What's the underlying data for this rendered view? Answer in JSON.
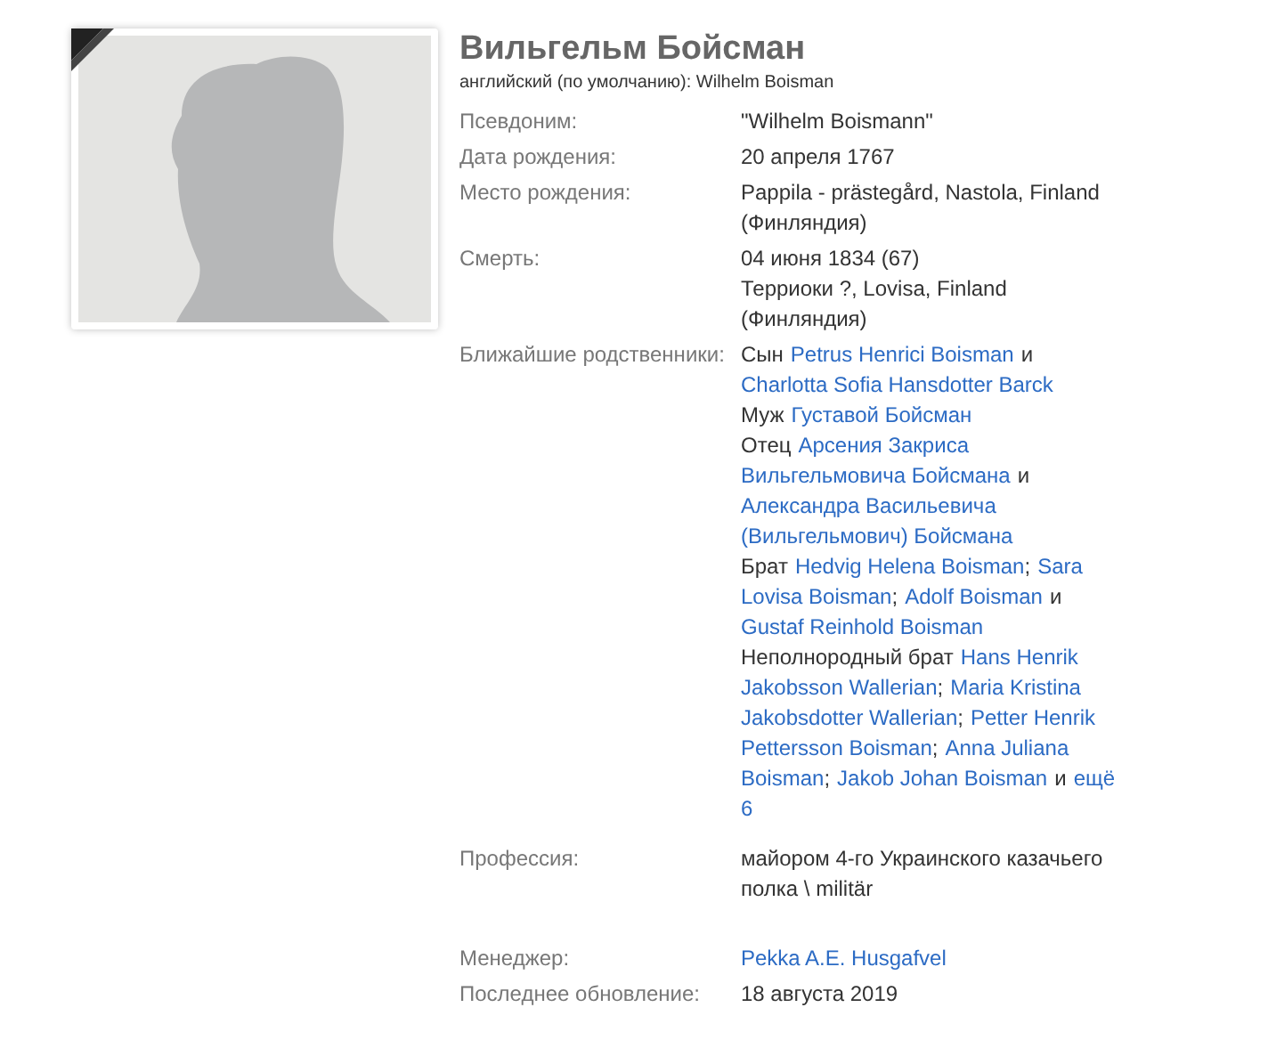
{
  "profile": {
    "name": "Вильгельм Бойсман",
    "alt_name": "английский (по умолчанию): Wilhelm Boisman",
    "deceased": true
  },
  "facts": [
    {
      "label": "Псевдоним:",
      "lines": [
        "\"Wilhelm Boismann\""
      ]
    },
    {
      "label": "Дата рождения:",
      "lines": [
        "20 апреля 1767"
      ]
    },
    {
      "label": "Место рождения:",
      "lines": [
        "Pappila - prästegård, Nastola, Finland",
        "(Финляндия)"
      ]
    },
    {
      "label": "Смерть:",
      "lines": [
        "04 июня 1834 (67)",
        "Терриоки ?, Lovisa, Finland",
        "(Финляндия)"
      ]
    }
  ],
  "relatives": {
    "label": "Ближайшие родственники:",
    "lines": [
      [
        {
          "kind": "plain",
          "text": "Сын"
        },
        {
          "kind": "link",
          "text": "Petrus Henrici Boisman"
        },
        {
          "kind": "plain",
          "text": "и"
        }
      ],
      [
        {
          "kind": "link",
          "text": "Charlotta Sofia Hansdotter Barck"
        }
      ],
      [
        {
          "kind": "plain",
          "text": "Муж"
        },
        {
          "kind": "link",
          "text": "Густавой Бойсман"
        }
      ],
      [
        {
          "kind": "plain",
          "text": "Отец"
        },
        {
          "kind": "link",
          "text": "Арсения Закриса"
        }
      ],
      [
        {
          "kind": "link",
          "text": "Вильгельмовича Бойсмана"
        },
        {
          "kind": "plain",
          "text": "и"
        }
      ],
      [
        {
          "kind": "link",
          "text": "Александра Васильевича"
        }
      ],
      [
        {
          "kind": "link",
          "text": "(Вильгельмович) Бойсмана"
        }
      ],
      [
        {
          "kind": "plain",
          "text": "Брат"
        },
        {
          "kind": "link",
          "text": "Hedvig Helena Boisman"
        },
        {
          "kind": "sep",
          "text": ";"
        },
        {
          "kind": "link",
          "text": "Sara"
        }
      ],
      [
        {
          "kind": "link",
          "text": "Lovisa Boisman"
        },
        {
          "kind": "sep",
          "text": ";"
        },
        {
          "kind": "link",
          "text": "Adolf Boisman"
        },
        {
          "kind": "plain",
          "text": "и"
        }
      ],
      [
        {
          "kind": "link",
          "text": "Gustaf Reinhold Boisman"
        }
      ],
      [
        {
          "kind": "plain",
          "text": "Неполнородный брат"
        },
        {
          "kind": "link",
          "text": "Hans Henrik"
        }
      ],
      [
        {
          "kind": "link",
          "text": "Jakobsson Wallerian"
        },
        {
          "kind": "sep",
          "text": ";"
        },
        {
          "kind": "link",
          "text": "Maria Kristina"
        }
      ],
      [
        {
          "kind": "link",
          "text": "Jakobsdotter Wallerian"
        },
        {
          "kind": "sep",
          "text": ";"
        },
        {
          "kind": "link",
          "text": "Petter Henrik"
        }
      ],
      [
        {
          "kind": "link",
          "text": "Pettersson Boisman"
        },
        {
          "kind": "sep",
          "text": ";"
        },
        {
          "kind": "link",
          "text": "Anna Juliana"
        }
      ],
      [
        {
          "kind": "link",
          "text": "Boisman"
        },
        {
          "kind": "sep",
          "text": ";"
        },
        {
          "kind": "link",
          "text": "Jakob Johan Boisman"
        },
        {
          "kind": "plain",
          "text": "и"
        },
        {
          "kind": "link",
          "text": "ещё"
        }
      ],
      [
        {
          "kind": "link",
          "text": "6"
        }
      ]
    ]
  },
  "profession": {
    "label": "Профессия:",
    "lines": [
      "майором 4-го Украинского казачьего",
      "полка \\ militär"
    ]
  },
  "manager": {
    "label": "Менеджер:",
    "value": "Pekka A.E. Husgafvel"
  },
  "updated": {
    "label": "Последнее обновление:",
    "value": "18 августа 2019"
  }
}
